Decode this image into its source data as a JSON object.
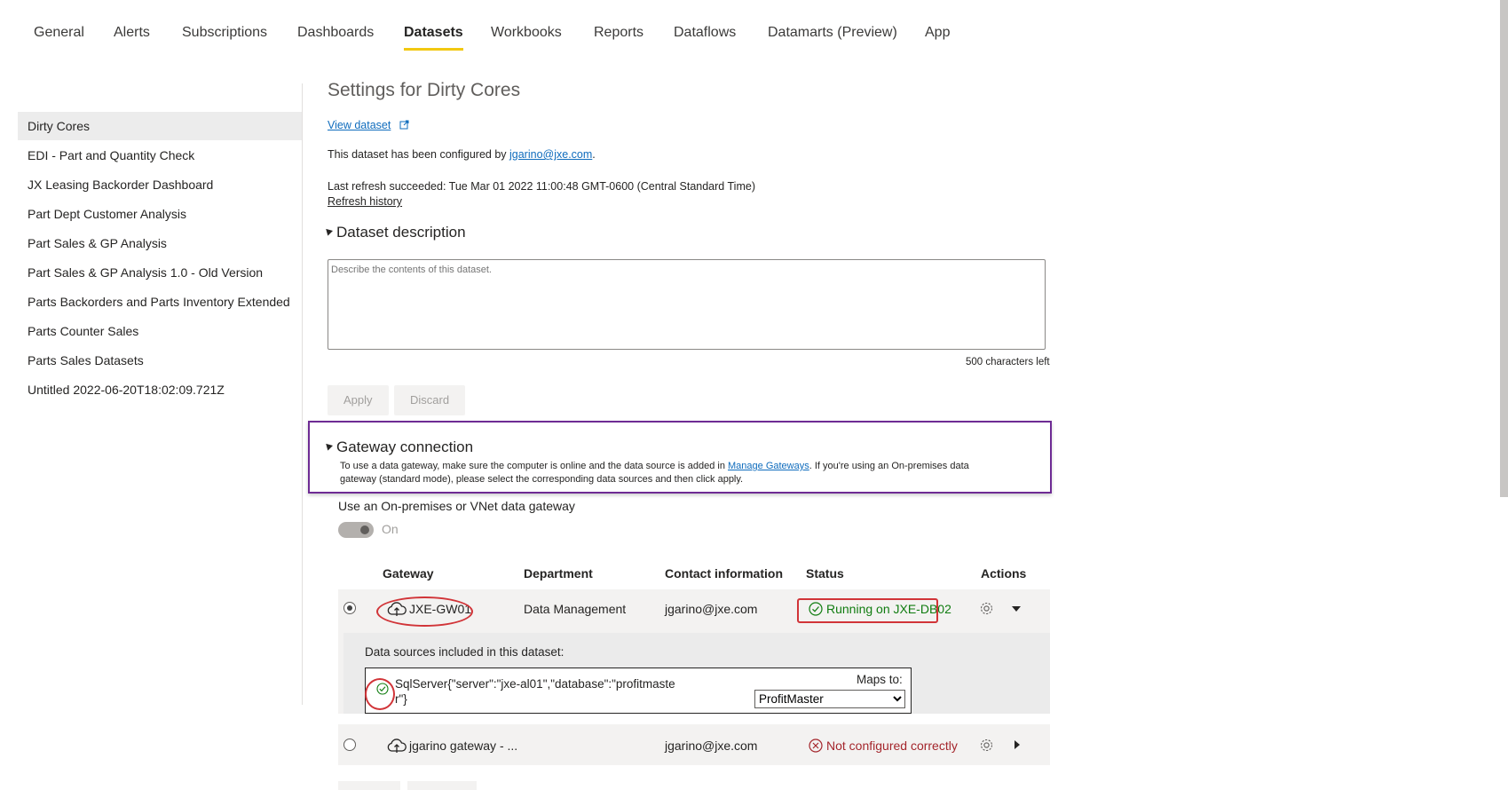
{
  "tabs": [
    "General",
    "Alerts",
    "Subscriptions",
    "Dashboards",
    "Datasets",
    "Workbooks",
    "Reports",
    "Dataflows",
    "Datamarts (Preview)",
    "App"
  ],
  "active_tab": "Datasets",
  "sidebar": {
    "items": [
      "Dirty Cores",
      "EDI - Part and Quantity Check",
      "JX Leasing Backorder Dashboard",
      "Part Dept Customer Analysis",
      "Part Sales & GP Analysis",
      "Part Sales & GP Analysis 1.0 - Old Version",
      "Parts Backorders and Parts Inventory Extended",
      "Parts Counter Sales",
      "Parts Sales Datasets",
      "Untitled 2022-06-20T18:02:09.721Z"
    ],
    "selected": "Dirty Cores"
  },
  "main": {
    "title": "Settings for Dirty Cores",
    "view_dataset": "View dataset",
    "configured_prefix": "This dataset has been configured by ",
    "configured_email": "jgarino@jxe.com",
    "configured_suffix": ".",
    "last_refresh": "Last refresh succeeded: Tue Mar 01 2022 11:00:48 GMT-0600 (Central Standard Time)",
    "refresh_history": "Refresh history",
    "description_heading": "Dataset description",
    "description_placeholder": "Describe the contents of this dataset.",
    "chars_left": "500 characters left",
    "apply": "Apply",
    "discard": "Discard",
    "gateway_heading": "Gateway connection",
    "gateway_text_1": "To use a data gateway, make sure the computer is online and the data source is added in ",
    "gateway_link": "Manage Gateways",
    "gateway_text_2": ". If you're using an On-premises data",
    "gateway_text_3": "gateway (standard mode), please select the corresponding data sources and then click apply.",
    "use_gateway_label": "Use an On-premises or VNet data gateway",
    "toggle_label": "On",
    "toggle_on": true
  },
  "table": {
    "headers": [
      "Gateway",
      "Department",
      "Contact information",
      "Status",
      "Actions"
    ],
    "rows": [
      {
        "gateway": "JXE-GW01",
        "department": "Data Management",
        "contact": "jgarino@jxe.com",
        "status": "Running on JXE-DB02",
        "status_color": "#107c10",
        "selected": true
      },
      {
        "gateway": "jgarino gateway - ...",
        "department": "",
        "contact": "jgarino@jxe.com",
        "status": "Not configured correctly",
        "status_color": "#a4262c",
        "selected": false
      }
    ],
    "data_sources_label": "Data sources included in this dataset:",
    "data_source_line1": "SqlServer{\"server\":\"jxe-al01\",\"database\":\"profitmaste",
    "data_source_line2": "r\"}",
    "maps_to_label": "Maps to:",
    "maps_to_value": "ProfitMaster"
  },
  "colors": {
    "accent_tab": "#f2c811",
    "highlight_box": "#6e2b94",
    "annotation_red": "#d13438",
    "link": "#0f6cbd"
  }
}
